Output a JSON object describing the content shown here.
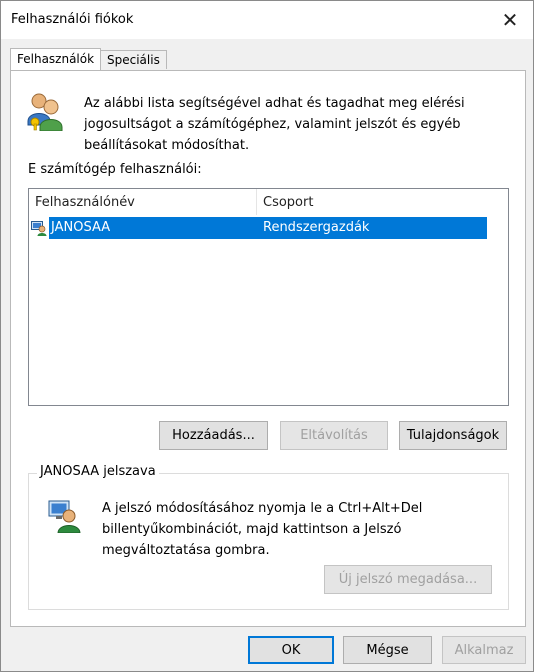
{
  "window": {
    "title": "Felhasználói fiókok"
  },
  "tabs": [
    {
      "label": "Felhasználók",
      "active": true
    },
    {
      "label": "Speciális",
      "active": false
    }
  ],
  "users_tab": {
    "description": "Az alábbi lista segítségével adhat és tagadhat meg elérési jogosultságot a számítógéphez, valamint jelszót és egyéb beállításokat módosíthat.",
    "list_label": "E számítógép felhasználói:",
    "columns": [
      "Felhasználónév",
      "Csoport"
    ],
    "rows": [
      {
        "username": "JANOSAA",
        "group": "Rendszergazdák",
        "selected": true
      }
    ],
    "buttons": {
      "add": "Hozzáadás...",
      "remove": "Eltávolítás",
      "properties": "Tulajdonságok"
    },
    "password_group": {
      "label": "JANOSAA jelszava",
      "description": "A jelszó módosításához nyomja le a Ctrl+Alt+Del billentyűkombinációt, majd kattintson a Jelszó megváltoztatása gombra.",
      "new_password_button": "Új jelszó megadása..."
    }
  },
  "dialog_buttons": {
    "ok": "OK",
    "cancel": "Mégse",
    "apply": "Alkalmaz"
  },
  "colors": {
    "selection": "#0078d7",
    "disabled_text": "#a0a0a0"
  },
  "icons": {
    "users": "users-icon",
    "user": "user-icon",
    "password": "user-key-icon",
    "close": "close-icon"
  }
}
